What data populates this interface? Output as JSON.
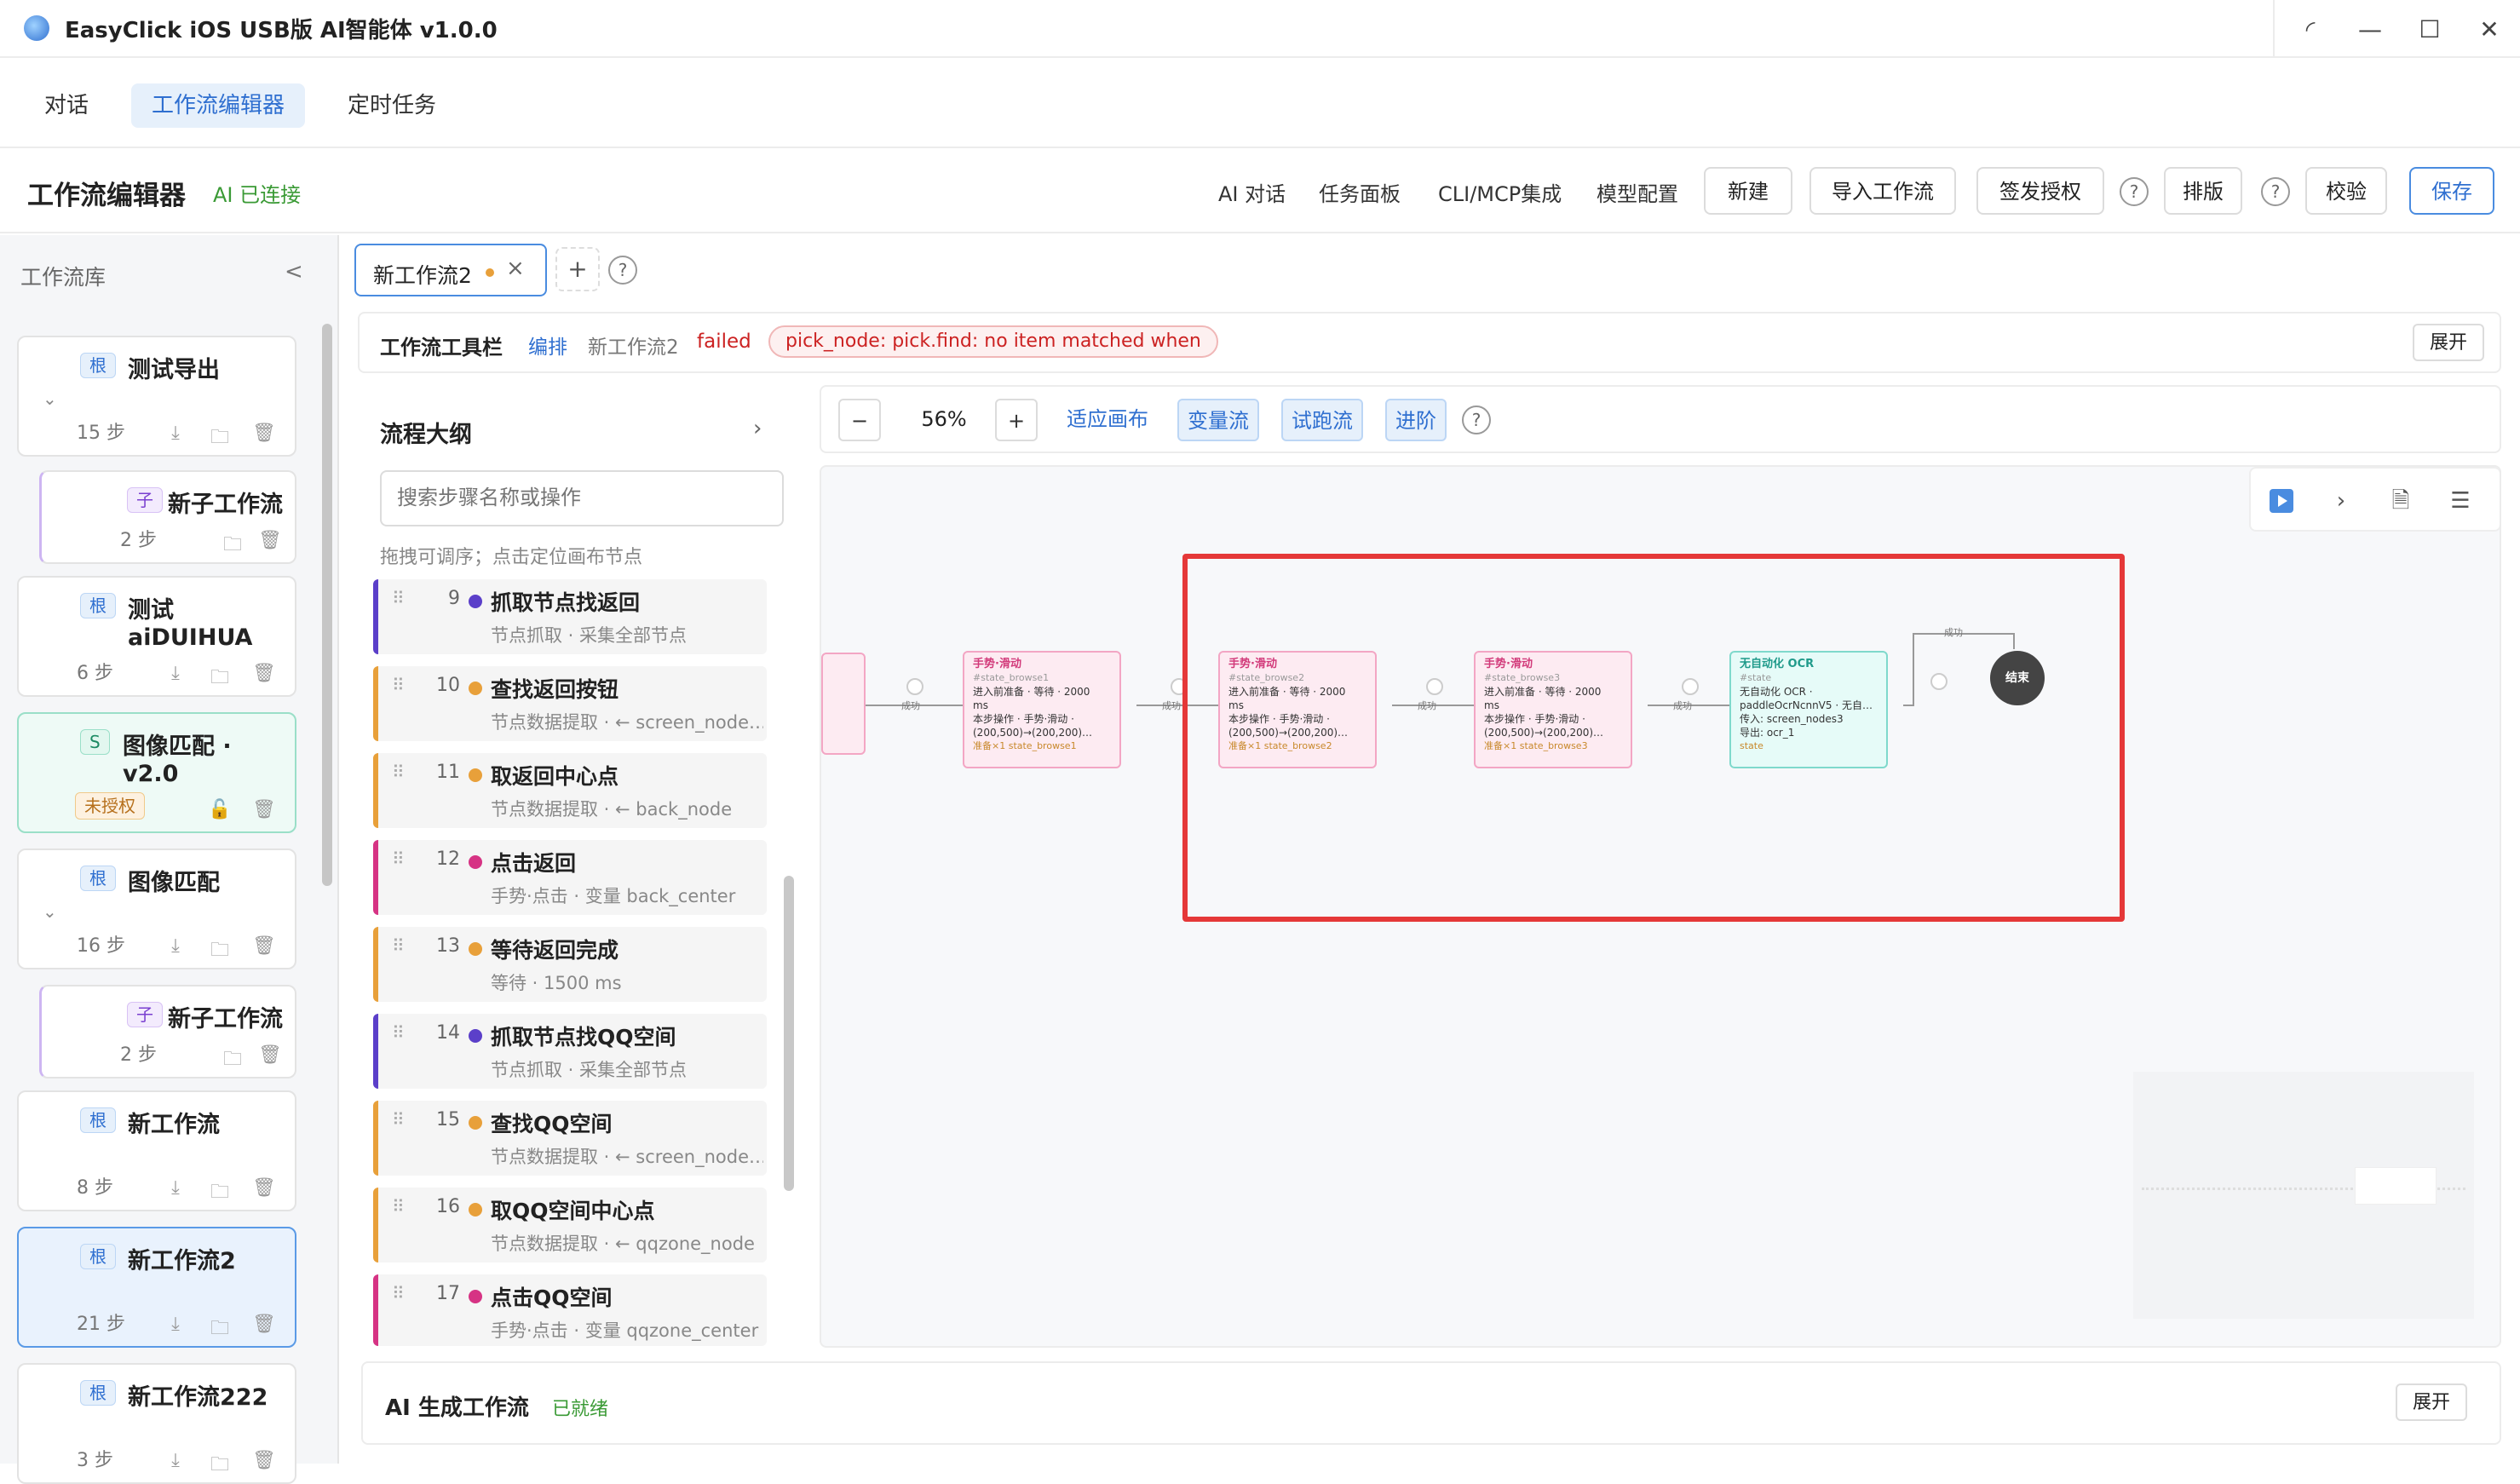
{
  "window": {
    "title": "EasyClick iOS USB版 AI智能体 v1.0.0"
  },
  "top_tabs": [
    {
      "label": "对话"
    },
    {
      "label": "工作流编辑器"
    },
    {
      "label": "定时任务"
    }
  ],
  "header": {
    "title": "工作流编辑器",
    "ai_status": "AI 已连接",
    "links": [
      "AI 对话",
      "任务面板",
      "CLI/MCP集成",
      "模型配置"
    ],
    "buttons": {
      "new": "新建",
      "import": "导入工作流",
      "license": "签发授权",
      "layout": "排版",
      "validate": "校验",
      "save": "保存"
    },
    "help": "?"
  },
  "sidebar": {
    "title": "工作流库",
    "collapse": "<",
    "cards": [
      {
        "badge": "根",
        "name": "测试导出",
        "steps": "15 步"
      },
      {
        "badge": "子",
        "name": "新子工作流",
        "steps": "2 步"
      },
      {
        "badge": "根",
        "name": "测试aiDUIHUA",
        "steps": "6 步"
      },
      {
        "badge": "S",
        "name": "图像匹配 · v2.0",
        "status": "未授权"
      },
      {
        "badge": "根",
        "name": "图像匹配",
        "steps": "16 步"
      },
      {
        "badge": "子",
        "name": "新子工作流",
        "steps": "2 步"
      },
      {
        "badge": "根",
        "name": "新工作流",
        "steps": "8 步"
      },
      {
        "badge": "根",
        "name": "新工作流2",
        "steps": "21 步"
      },
      {
        "badge": "根",
        "name": "新工作流222",
        "steps": "3 步"
      }
    ]
  },
  "doc_tab": {
    "label": "新工作流2",
    "close": "×",
    "add": "+",
    "help": "?"
  },
  "toolbar": {
    "title": "工作流工具栏",
    "mode": "编排",
    "workflow": "新工作流2",
    "status": "failed",
    "error": "pick_node: pick.find: no item matched when",
    "expand": "展开"
  },
  "outline": {
    "title": "流程大纲",
    "search_placeholder": "搜索步骤名称或操作",
    "hint": "拖拽可调序；点击定位画布节点",
    "steps": [
      {
        "num": "9",
        "title": "抓取节点找返回",
        "desc": "节点抓取 · 采集全部节点",
        "color": "#5b3fc9"
      },
      {
        "num": "10",
        "title": "查找返回按钮",
        "desc": "节点数据提取 · ← screen_node…",
        "color": "#e8a03a"
      },
      {
        "num": "11",
        "title": "取返回中心点",
        "desc": "节点数据提取 · ← back_node",
        "color": "#e8a03a"
      },
      {
        "num": "12",
        "title": "点击返回",
        "desc": "手势·点击 · 变量 back_center",
        "color": "#d63384"
      },
      {
        "num": "13",
        "title": "等待返回完成",
        "desc": "等待 · 1500 ms",
        "color": "#e8a03a"
      },
      {
        "num": "14",
        "title": "抓取节点找QQ空间",
        "desc": "节点抓取 · 采集全部节点",
        "color": "#5b3fc9"
      },
      {
        "num": "15",
        "title": "查找QQ空间",
        "desc": "节点数据提取 · ← screen_node…",
        "color": "#e8a03a"
      },
      {
        "num": "16",
        "title": "取QQ空间中心点",
        "desc": "节点数据提取 · ← qqzone_node",
        "color": "#e8a03a"
      },
      {
        "num": "17",
        "title": "点击QQ空间",
        "desc": "手势·点击 · 变量 qqzone_center",
        "color": "#d63384"
      }
    ]
  },
  "canvas_toolbar": {
    "zoom_out": "−",
    "zoom": "56%",
    "zoom_in": "+",
    "fit": "适应画布",
    "var_flow": "变量流",
    "trial_run": "试跑流",
    "advanced": "进阶",
    "help": "?"
  },
  "canvas": {
    "edge_label": "成功",
    "nodes": [
      {
        "title": "手势·滑动",
        "id": "#state_browse1",
        "lines": [
          "进入前准备 · 等待 · 2000",
          "ms",
          "本步操作 · 手势·滑动 ·",
          "(200,500)→(200,200)…"
        ],
        "footer": "准备×1  state_browse1"
      },
      {
        "title": "手势·滑动",
        "id": "#state_browse2",
        "lines": [
          "进入前准备 · 等待 · 2000",
          "ms",
          "本步操作 · 手势·滑动 ·",
          "(200,500)→(200,200)…"
        ],
        "footer": "准备×1  state_browse2"
      },
      {
        "title": "手势·滑动",
        "id": "#state_browse3",
        "lines": [
          "进入前准备 · 等待 · 2000",
          "ms",
          "本步操作 · 手势·滑动 ·",
          "(200,500)→(200,200)…"
        ],
        "footer": "准备×1  state_browse3"
      },
      {
        "title": "无自动化 OCR",
        "id": "#state",
        "lines": [
          "无自动化 OCR ·",
          "paddleOcrNcnnV5 · 无自…",
          "传入: screen_nodes3",
          "导出: ocr_1"
        ],
        "footer": "state"
      }
    ],
    "end_label": "结束"
  },
  "ai_panel": {
    "title": "AI 生成工作流",
    "status": "已就绪",
    "expand": "展开"
  }
}
